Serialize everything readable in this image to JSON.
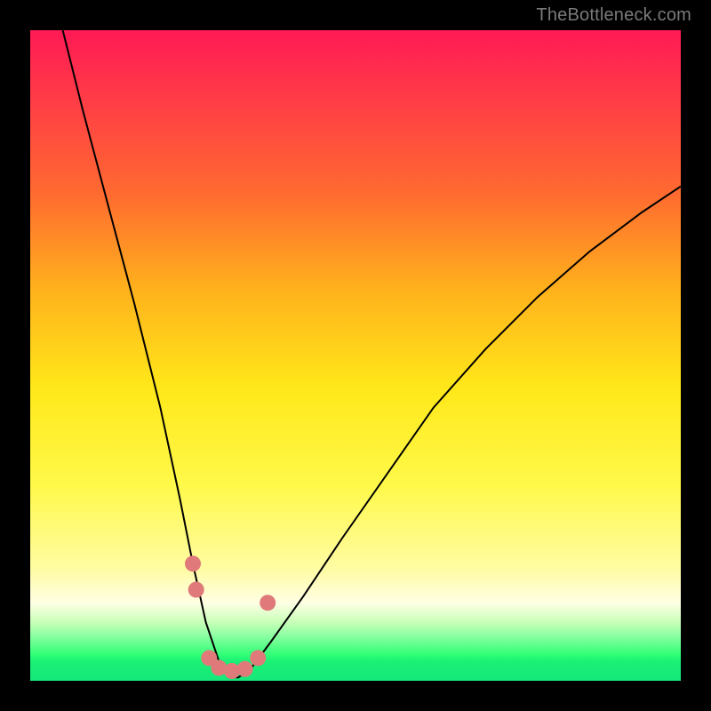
{
  "watermark": "TheBottleneck.com",
  "chart_data": {
    "type": "line",
    "title": "",
    "xlabel": "",
    "ylabel": "",
    "xlim": [
      0,
      100
    ],
    "ylim": [
      0,
      100
    ],
    "background": {
      "kind": "vertical-gradient",
      "stops": [
        {
          "pct": 0,
          "color": "#ff1a55"
        },
        {
          "pct": 10,
          "color": "#ff3a47"
        },
        {
          "pct": 25,
          "color": "#ff6a30"
        },
        {
          "pct": 40,
          "color": "#ffb21c"
        },
        {
          "pct": 55,
          "color": "#ffe81a"
        },
        {
          "pct": 70,
          "color": "#fff94a"
        },
        {
          "pct": 83,
          "color": "#fffca5"
        },
        {
          "pct": 88,
          "color": "#ffffe5"
        },
        {
          "pct": 91,
          "color": "#c8ffb8"
        },
        {
          "pct": 93,
          "color": "#8effa3"
        },
        {
          "pct": 96,
          "color": "#30ff76"
        },
        {
          "pct": 100,
          "color": "#15e87a"
        }
      ]
    },
    "series": [
      {
        "name": "bottleneck-curve",
        "color": "#000000",
        "x": [
          5,
          8,
          12,
          16,
          20,
          23,
          25,
          27,
          29,
          30.5,
          32,
          34,
          37,
          42,
          48,
          55,
          62,
          70,
          78,
          86,
          94,
          100
        ],
        "y": [
          100,
          88,
          73,
          58,
          42,
          28,
          18,
          9,
          3,
          0.5,
          0.5,
          2,
          6,
          13,
          22,
          32,
          42,
          51,
          59,
          66,
          72,
          76
        ]
      }
    ],
    "markers": [
      {
        "name": "point-a",
        "x": 25.0,
        "y": 18,
        "color": "#e07a7a",
        "r": 9
      },
      {
        "name": "point-b",
        "x": 25.5,
        "y": 14,
        "color": "#e07a7a",
        "r": 9
      },
      {
        "name": "point-c",
        "x": 27.5,
        "y": 3.5,
        "color": "#e07a7a",
        "r": 9
      },
      {
        "name": "point-d",
        "x": 29.0,
        "y": 2.0,
        "color": "#e07a7a",
        "r": 9
      },
      {
        "name": "point-e",
        "x": 31.0,
        "y": 1.5,
        "color": "#e07a7a",
        "r": 9
      },
      {
        "name": "point-f",
        "x": 33.0,
        "y": 1.8,
        "color": "#e07a7a",
        "r": 9
      },
      {
        "name": "point-g",
        "x": 35.0,
        "y": 3.5,
        "color": "#e07a7a",
        "r": 9
      },
      {
        "name": "point-h",
        "x": 36.5,
        "y": 12,
        "color": "#e07a7a",
        "r": 9
      }
    ]
  }
}
